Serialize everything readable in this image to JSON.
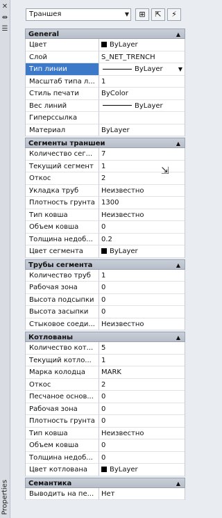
{
  "side": {
    "label": "Properties"
  },
  "toolbar": {
    "object_type": "Траншея"
  },
  "categories": [
    {
      "title": "General",
      "rows": [
        {
          "name": "Цвет",
          "value": "ByLayer",
          "kind": "swatch"
        },
        {
          "name": "Слой",
          "value": "S_NET_TRENCH"
        },
        {
          "name": "Тип линии",
          "value": "ByLayer",
          "kind": "line",
          "selected": true
        },
        {
          "name": "Масштаб типа л...",
          "value": "1"
        },
        {
          "name": "Стиль печати",
          "value": "ByColor"
        },
        {
          "name": "Вес линий",
          "value": "ByLayer",
          "kind": "line"
        },
        {
          "name": "Гиперссылка",
          "value": ""
        },
        {
          "name": "Материал",
          "value": "ByLayer"
        }
      ]
    },
    {
      "title": "Сегменты траншеи",
      "rows": [
        {
          "name": "Количество сег...",
          "value": "7"
        },
        {
          "name": "Текущий сегмент",
          "value": "1"
        },
        {
          "name": "Откос",
          "value": "2"
        },
        {
          "name": "Укладка труб",
          "value": "Неизвестно"
        },
        {
          "name": "Плотность грунта",
          "value": "1300"
        },
        {
          "name": "Тип ковша",
          "value": "Неизвестно"
        },
        {
          "name": "Объем ковша",
          "value": "0"
        },
        {
          "name": "Толщина недоб...",
          "value": "0.2"
        },
        {
          "name": "Цвет сегмента",
          "value": "ByLayer",
          "kind": "swatch"
        }
      ]
    },
    {
      "title": "Трубы сегмента",
      "rows": [
        {
          "name": "Количество труб",
          "value": "1"
        },
        {
          "name": "Рабочая зона",
          "value": "0"
        },
        {
          "name": "Высота подсыпки",
          "value": "0"
        },
        {
          "name": "Высота засыпки",
          "value": "0"
        },
        {
          "name": "Стыковое соеди...",
          "value": "Неизвестно"
        }
      ]
    },
    {
      "title": "Котлованы",
      "rows": [
        {
          "name": "Количество кот...",
          "value": "5"
        },
        {
          "name": "Текущий котло...",
          "value": "1"
        },
        {
          "name": "Марка колодца",
          "value": "MARK"
        },
        {
          "name": "Откос",
          "value": "2"
        },
        {
          "name": "Песчаное основ...",
          "value": "0"
        },
        {
          "name": "Рабочая зона",
          "value": "0"
        },
        {
          "name": "Плотность грунта",
          "value": "0"
        },
        {
          "name": "Тип ковша",
          "value": "Неизвестно"
        },
        {
          "name": "Объем ковша",
          "value": "0"
        },
        {
          "name": "Толщина недоб...",
          "value": "0"
        },
        {
          "name": "Цвет котлована",
          "value": "ByLayer",
          "kind": "swatch"
        }
      ]
    },
    {
      "title": "Семантика",
      "rows": [
        {
          "name": "Выводить на пе...",
          "value": "Нет"
        }
      ]
    }
  ]
}
